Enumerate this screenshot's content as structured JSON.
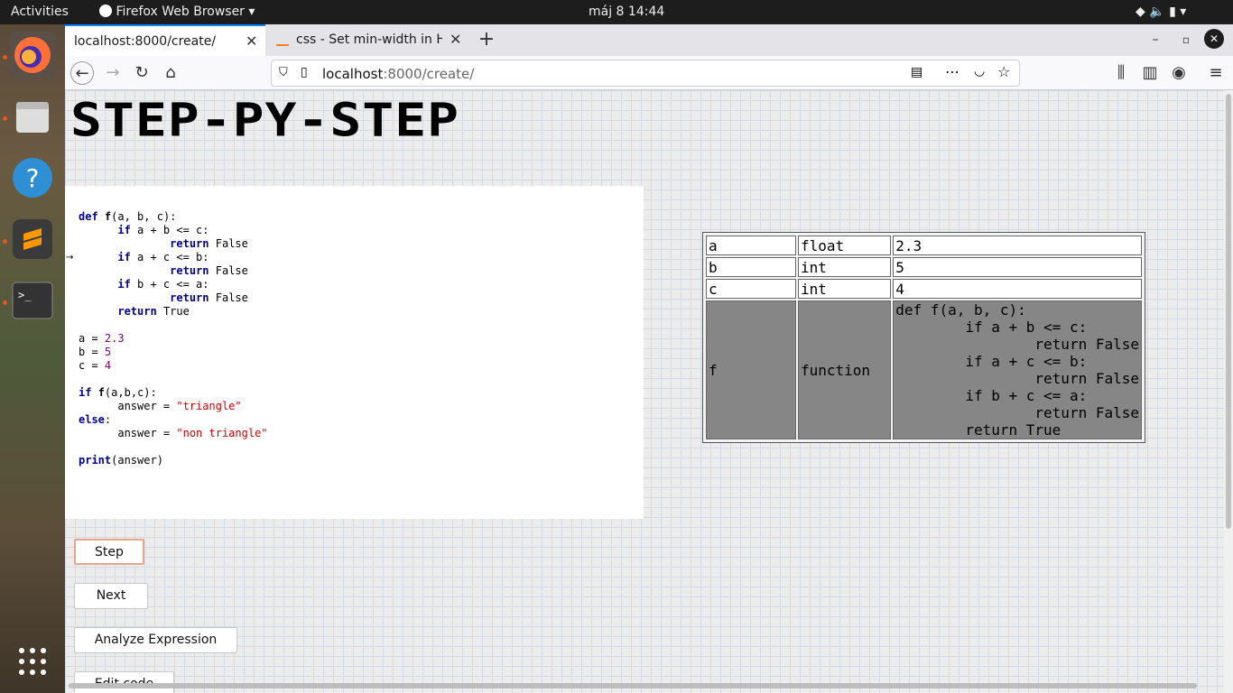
{
  "topbar": {
    "activities": "Activities",
    "app": "Firefox Web Browser",
    "clock": "máj 8  14:44"
  },
  "tabs": [
    {
      "title": "localhost:8000/create/",
      "active": true
    },
    {
      "title": "css - Set min-width in HTM",
      "active": false
    }
  ],
  "url": {
    "host": "localhost",
    "rest": ":8000/create/"
  },
  "page": {
    "logo": "STEP-PY-STEP",
    "buttons": {
      "step": "Step",
      "next": "Next",
      "analyze": "Analyze Expression",
      "edit": "Edit code"
    },
    "variables": [
      {
        "name": "a",
        "type": "float",
        "value": "2.3"
      },
      {
        "name": "b",
        "type": "int",
        "value": "5"
      },
      {
        "name": "c",
        "type": "int",
        "value": "4"
      },
      {
        "name": "f",
        "type": "function",
        "value": "def f(a, b, c):\n        if a + b <= c:\n                return False\n        if a + c <= b:\n                return False\n        if b + c <= a:\n                return False\n        return True"
      }
    ]
  },
  "colors": {
    "accent": "#e95420",
    "keyword": "#00008b",
    "number": "#800080",
    "string": "#d00000"
  }
}
